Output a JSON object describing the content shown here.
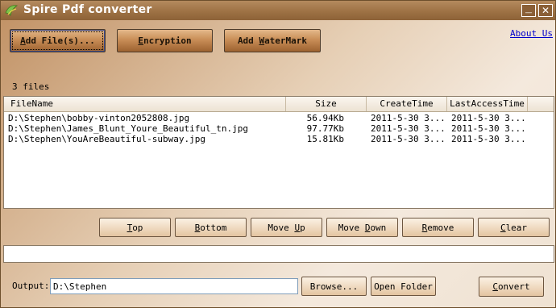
{
  "window": {
    "title": "Spire Pdf converter",
    "minimize_glyph": "—",
    "close_glyph": "✕"
  },
  "toolbar": {
    "add_files": {
      "pre": "",
      "key": "A",
      "post": "dd File(s)..."
    },
    "encryption": {
      "pre": "",
      "key": "E",
      "post": "ncryption"
    },
    "watermark": {
      "pre": "Add ",
      "key": "W",
      "post": "aterMark"
    },
    "about_link": "About Us"
  },
  "file_count": "3 files",
  "list": {
    "columns": [
      "FileName",
      "Size",
      "CreateTime",
      "LastAccessTime"
    ],
    "rows": [
      {
        "file": "D:\\Stephen\\bobby-vinton2052808.jpg",
        "size": "56.94Kb",
        "created": "2011-5-30 3...",
        "accessed": "2011-5-30 3..."
      },
      {
        "file": "D:\\Stephen\\James_Blunt_Youre_Beautiful_tn.jpg",
        "size": "97.77Kb",
        "created": "2011-5-30 3...",
        "accessed": "2011-5-30 3..."
      },
      {
        "file": "D:\\Stephen\\YouAreBeautiful-subway.jpg",
        "size": "15.81Kb",
        "created": "2011-5-30 3...",
        "accessed": "2011-5-30 3..."
      }
    ]
  },
  "list_actions": {
    "top": {
      "pre": "",
      "key": "T",
      "post": "op"
    },
    "bottom": {
      "pre": "",
      "key": "B",
      "post": "ottom"
    },
    "move_up": {
      "pre": "Move ",
      "key": "U",
      "post": "p"
    },
    "move_down": {
      "pre": "Move ",
      "key": "D",
      "post": "own"
    },
    "remove": {
      "pre": "",
      "key": "R",
      "post": "emove"
    },
    "clear": {
      "pre": "",
      "key": "C",
      "post": "lear"
    }
  },
  "progress": {
    "fraction": 0
  },
  "output": {
    "label": "Output:",
    "path": "D:\\Stephen",
    "browse": "Browse...",
    "open_folder": "Open Folder",
    "convert": {
      "pre": "",
      "key": "C",
      "post": "onvert"
    }
  }
}
